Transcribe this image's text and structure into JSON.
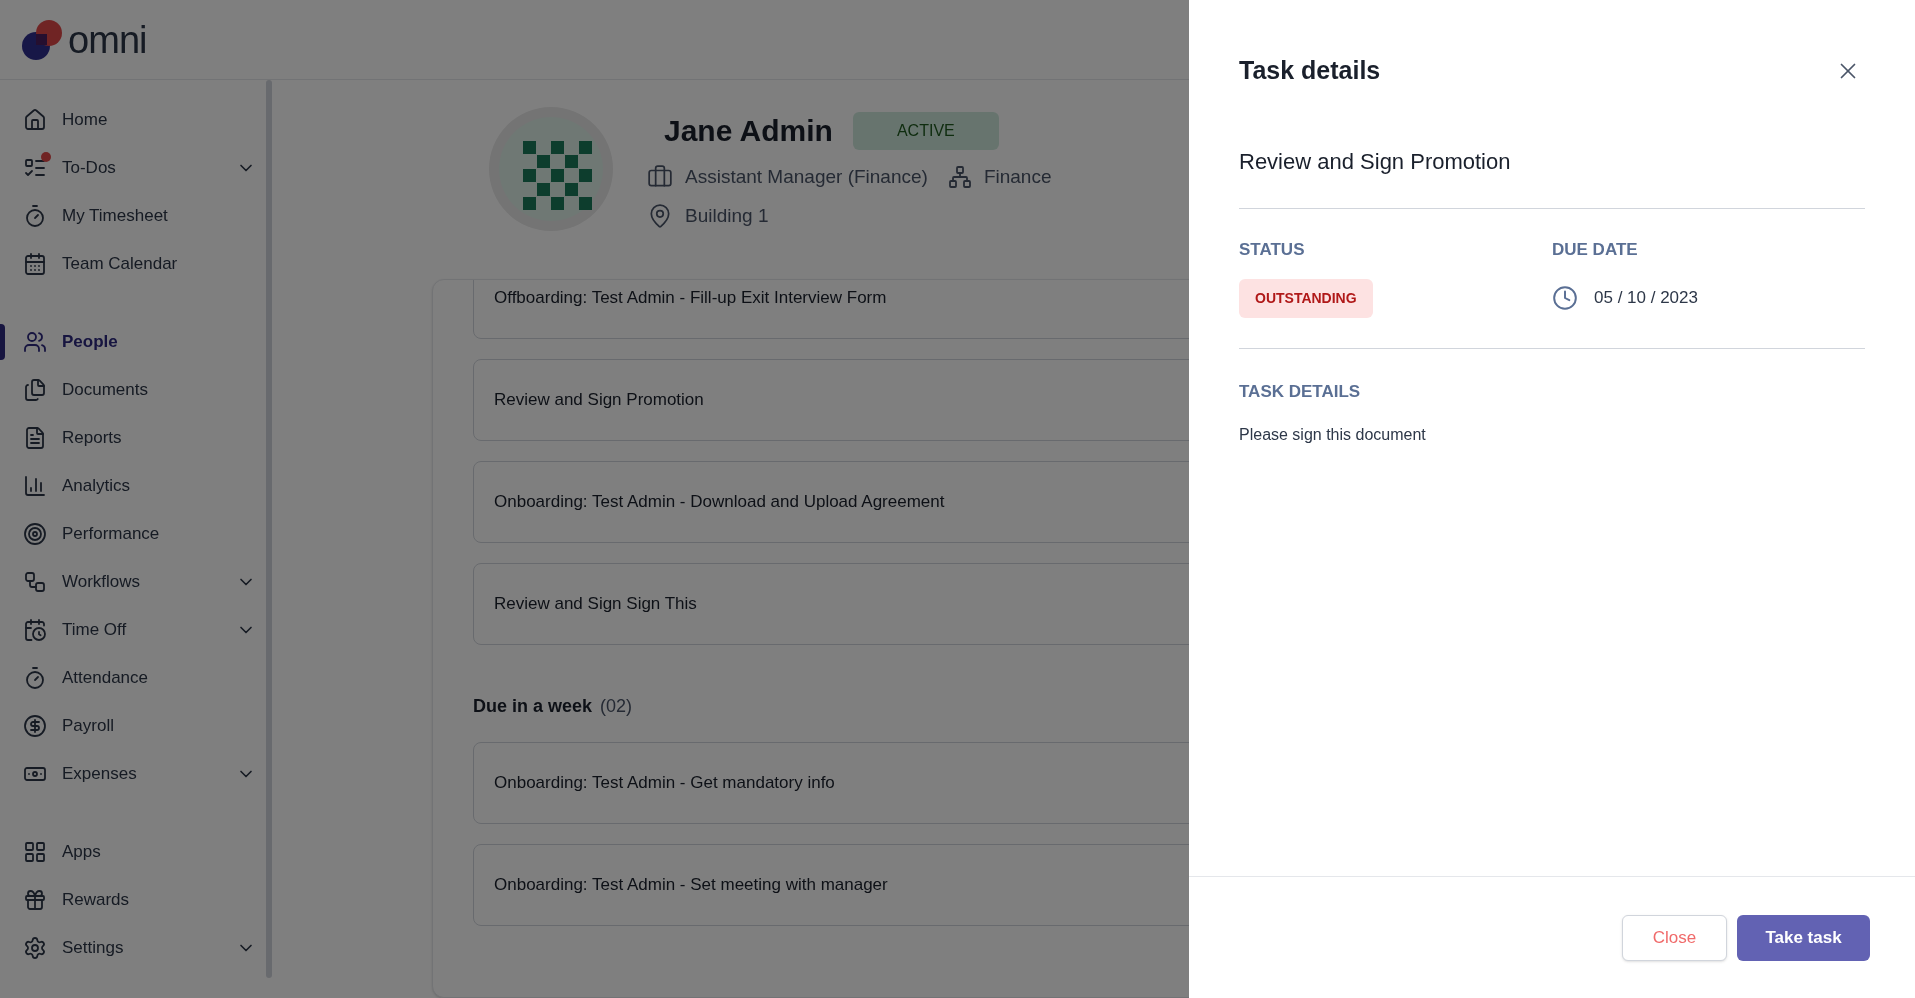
{
  "brand": {
    "name": "omni"
  },
  "sidebar": {
    "sections": [
      {
        "items": [
          {
            "label": "Home",
            "selected": false,
            "expandable": false,
            "notification": false
          },
          {
            "label": "To-Dos",
            "selected": false,
            "expandable": true,
            "notification": true
          },
          {
            "label": "My Timesheet",
            "selected": false,
            "expandable": false,
            "notification": false
          },
          {
            "label": "Team Calendar",
            "selected": false,
            "expandable": false,
            "notification": false
          }
        ]
      },
      {
        "items": [
          {
            "label": "People",
            "selected": true,
            "expandable": false,
            "notification": false
          },
          {
            "label": "Documents",
            "selected": false,
            "expandable": false,
            "notification": false
          },
          {
            "label": "Reports",
            "selected": false,
            "expandable": false,
            "notification": false
          },
          {
            "label": "Analytics",
            "selected": false,
            "expandable": false,
            "notification": false
          },
          {
            "label": "Performance",
            "selected": false,
            "expandable": false,
            "notification": false
          },
          {
            "label": "Workflows",
            "selected": false,
            "expandable": true,
            "notification": false
          },
          {
            "label": "Time Off",
            "selected": false,
            "expandable": true,
            "notification": false
          },
          {
            "label": "Attendance",
            "selected": false,
            "expandable": false,
            "notification": false
          },
          {
            "label": "Payroll",
            "selected": false,
            "expandable": false,
            "notification": false
          },
          {
            "label": "Expenses",
            "selected": false,
            "expandable": true,
            "notification": false
          }
        ]
      },
      {
        "items": [
          {
            "label": "Apps",
            "selected": false,
            "expandable": false,
            "notification": false
          },
          {
            "label": "Rewards",
            "selected": false,
            "expandable": false,
            "notification": false
          },
          {
            "label": "Settings",
            "selected": false,
            "expandable": true,
            "notification": false
          }
        ]
      }
    ]
  },
  "profile": {
    "name": "Jane Admin",
    "status": "ACTIVE",
    "position": "Assistant Manager (Finance)",
    "department": "Finance",
    "location": "Building 1"
  },
  "tasks": {
    "groups": [
      {
        "items": [
          "Offboarding: Test Admin - Fill-up Exit Interview Form",
          "Review and Sign Promotion",
          "Onboarding: Test Admin - Download and Upload Agreement",
          "Review and Sign Sign This"
        ]
      },
      {
        "title": "Due in a week",
        "count": "(02)",
        "items": [
          "Onboarding: Test Admin - Get mandatory info",
          "Onboarding: Test Admin - Set meeting with manager"
        ]
      }
    ]
  },
  "panel": {
    "title": "Task details",
    "task_title": "Review and Sign Promotion",
    "status_label": "STATUS",
    "status": "OUTSTANDING",
    "due_label": "DUE DATE",
    "due_date": "05 / 10 / 2023",
    "details_label": "TASK DETAILS",
    "details": "Please sign this document",
    "buttons": [
      {
        "label": "Close",
        "kind": "secondary"
      },
      {
        "label": "Take task",
        "kind": "primary"
      }
    ]
  }
}
